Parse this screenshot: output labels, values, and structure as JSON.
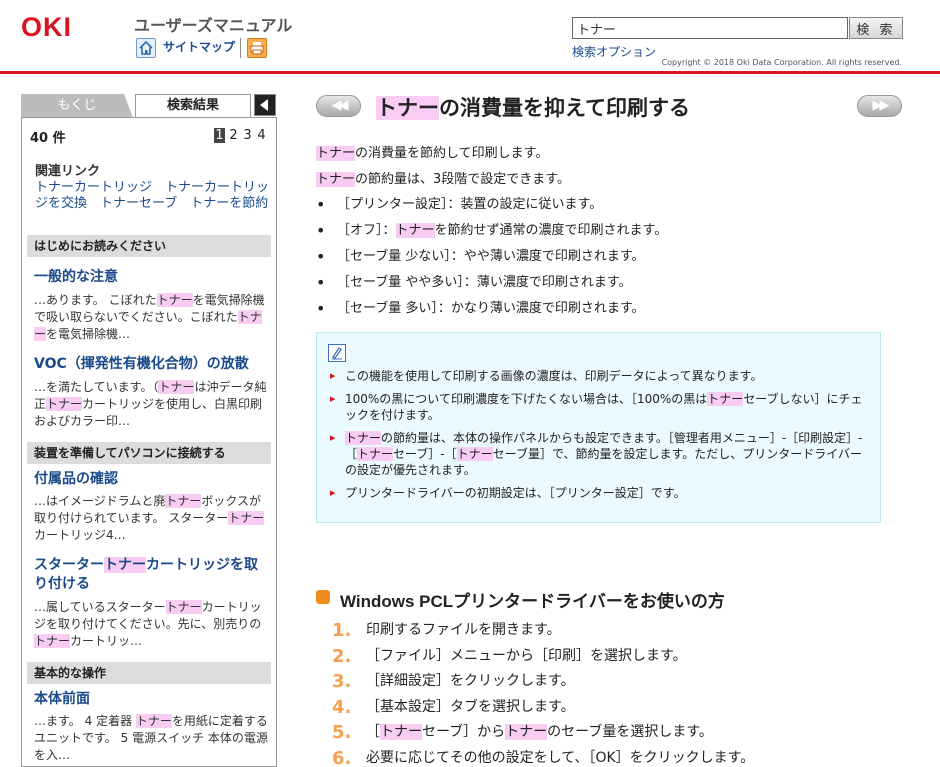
{
  "header": {
    "logo": "OKI",
    "manual_title": "ユーザーズマニュアル",
    "sitemap": "サイトマップ",
    "search": {
      "value": "トナー",
      "button": "検 索",
      "options": "検索オプション"
    },
    "copyright": "Copyright © 2018 Oki Data Corporation. All rights reserved."
  },
  "sidebar": {
    "tabs": {
      "contents": "もくじ",
      "results": "検索結果"
    },
    "result_count": "40 件",
    "pages": [
      "1",
      "2",
      "3",
      "4"
    ],
    "related": {
      "title": "関連リンク",
      "links": "トナーカートリッジ　トナーカートリッジを交換　トナーセーブ　トナーを節約"
    },
    "sections": [
      {
        "header": "はじめにお読みください"
      },
      {
        "header": "装置を準備してパソコンに接続する"
      },
      {
        "header": "基本的な操作"
      }
    ],
    "results": [
      {
        "title": "一般的な注意",
        "snippet": "…あります。 こぼれたトナーを電気掃除機で吸い取らないでください。こぼれたトナーを電気掃除機…"
      },
      {
        "title": "VOC（揮発性有機化合物）の放散",
        "snippet": "…を満たしています。（トナーは沖データ純正トナーカートリッジを使用し、白黒印刷およびカラー印…"
      },
      {
        "title": "付属品の確認",
        "snippet": "…はイメージドラムと廃トナーボックスが取り付けられています。 スタータートナーカートリッジ4…"
      },
      {
        "title": "スタータートナーカートリッジを取り付ける",
        "snippet": "…属しているスタータートナーカートリッジを取り付けてください。先に、別売りのトナーカートリッ…"
      },
      {
        "title": "本体前面",
        "snippet": "…ます。 4 定着器 トナーを用紙に定着するユニットです。 5 電源スイッチ 本体の電源を入…"
      }
    ]
  },
  "main": {
    "title": "トナーの消費量を抑えて印刷する",
    "intro": [
      "トナーの消費量を節約して印刷します。",
      "トナーの節約量は、3段階で設定できます。"
    ],
    "settings": [
      "［プリンター設定］：装置の設定に従います。",
      "［オフ］：トナーを節約せず通常の濃度で印刷されます。",
      "［セーブ量 少ない］：やや薄い濃度で印刷されます。",
      "［セーブ量 やや多い］：薄い濃度で印刷されます。",
      "［セーブ量 多い］：かなり薄い濃度で印刷されます。"
    ],
    "notes": [
      "この機能を使用して印刷する画像の濃度は、印刷データによって異なります。",
      "100%の黒について印刷濃度を下げたくない場合は、［100%の黒はトナーセーブしない］にチェックを付けます。",
      "トナーの節約量は、本体の操作パネルからも設定できます。［管理者用メニュー］-［印刷設定］-［トナーセーブ］-［トナーセーブ量］で、節約量を設定します。ただし、プリンタードライバーの設定が優先されます。",
      "プリンタードライバーの初期設定は、［プリンター設定］です。"
    ],
    "section_heading": "Windows PCLプリンタードライバーをお使いの方",
    "steps": [
      {
        "num": "1.",
        "text": "印刷するファイルを開きます。"
      },
      {
        "num": "2.",
        "text": "［ファイル］メニューから［印刷］を選択します。"
      },
      {
        "num": "3.",
        "text": "［詳細設定］をクリックします。"
      },
      {
        "num": "4.",
        "text": "［基本設定］タブを選択します。"
      },
      {
        "num": "5.",
        "text": "［トナーセーブ］からトナーのセーブ量を選択します。"
      },
      {
        "num": "6.",
        "text": "必要に応じてその他の設定をして、［OK］をクリックします。"
      }
    ]
  },
  "highlight_term": "トナー",
  "colors": {
    "brand": "#d8141e",
    "link": "#1a4a8a",
    "highlight": "#f9ccf4",
    "step_number": "#f4a04e",
    "note_bg": "#eafaff"
  }
}
